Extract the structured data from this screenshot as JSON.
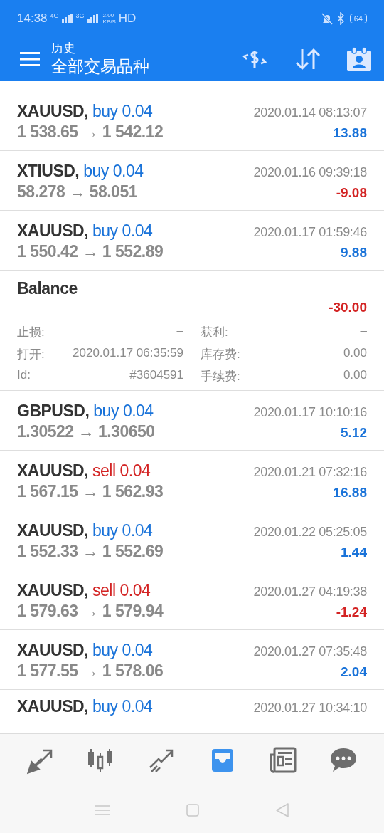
{
  "status_bar": {
    "time": "14:38",
    "network_1": "4G",
    "network_2": "3G",
    "speed": "2.00",
    "speed_unit": "KB/S",
    "hd": "HD",
    "battery": "64"
  },
  "header": {
    "title": "历史",
    "subtitle": "全部交易品种"
  },
  "rows": [
    {
      "kind": "trade",
      "symbol": "XAUUSD,",
      "side": "buy",
      "volume": "0.04",
      "time": "2020.01.14 08:13:07",
      "prices": "1 538.65 → 1 542.12",
      "profit": "13.88",
      "loss": false
    },
    {
      "kind": "trade",
      "symbol": "XTIUSD,",
      "side": "buy",
      "volume": "0.04",
      "time": "2020.01.16 09:39:18",
      "prices": "58.278 → 58.051",
      "profit": "-9.08",
      "loss": true
    },
    {
      "kind": "trade",
      "symbol": "XAUUSD,",
      "side": "buy",
      "volume": "0.04",
      "time": "2020.01.17 01:59:46",
      "prices": "1 550.42 → 1 552.89",
      "profit": "9.88",
      "loss": false
    },
    {
      "kind": "balance",
      "title": "Balance",
      "profit": "-30.00",
      "loss": true,
      "details": [
        {
          "label": "止损:",
          "value": "–"
        },
        {
          "label": "获利:",
          "value": "–"
        },
        {
          "label": "打开:",
          "value": "2020.01.17 06:35:59"
        },
        {
          "label": "库存费:",
          "value": "0.00"
        },
        {
          "label": "Id:",
          "value": "#3604591"
        },
        {
          "label": "手续费:",
          "value": "0.00"
        }
      ]
    },
    {
      "kind": "trade",
      "symbol": "GBPUSD,",
      "side": "buy",
      "volume": "0.04",
      "time": "2020.01.17 10:10:16",
      "prices": "1.30522 → 1.30650",
      "profit": "5.12",
      "loss": false
    },
    {
      "kind": "trade",
      "symbol": "XAUUSD,",
      "side": "sell",
      "volume": "0.04",
      "time": "2020.01.21 07:32:16",
      "prices": "1 567.15 → 1 562.93",
      "profit": "16.88",
      "loss": false
    },
    {
      "kind": "trade",
      "symbol": "XAUUSD,",
      "side": "buy",
      "volume": "0.04",
      "time": "2020.01.22 05:25:05",
      "prices": "1 552.33 → 1 552.69",
      "profit": "1.44",
      "loss": false
    },
    {
      "kind": "trade",
      "symbol": "XAUUSD,",
      "side": "sell",
      "volume": "0.04",
      "time": "2020.01.27 04:19:38",
      "prices": "1 579.63 → 1 579.94",
      "profit": "-1.24",
      "loss": true
    },
    {
      "kind": "trade",
      "symbol": "XAUUSD,",
      "side": "buy",
      "volume": "0.04",
      "time": "2020.01.27 07:35:48",
      "prices": "1 577.55 → 1 578.06",
      "profit": "2.04",
      "loss": false
    },
    {
      "kind": "trade",
      "symbol": "XAUUSD,",
      "side": "buy",
      "volume": "0.04",
      "time": "2020.01.27 10:34:10"
    }
  ],
  "nav": [
    {
      "kind": "trade",
      "selected": false
    },
    {
      "kind": "chart",
      "selected": false
    },
    {
      "kind": "quotes",
      "selected": false
    },
    {
      "kind": "history",
      "selected": true
    },
    {
      "kind": "news",
      "selected": false
    },
    {
      "kind": "chat",
      "selected": false
    }
  ]
}
